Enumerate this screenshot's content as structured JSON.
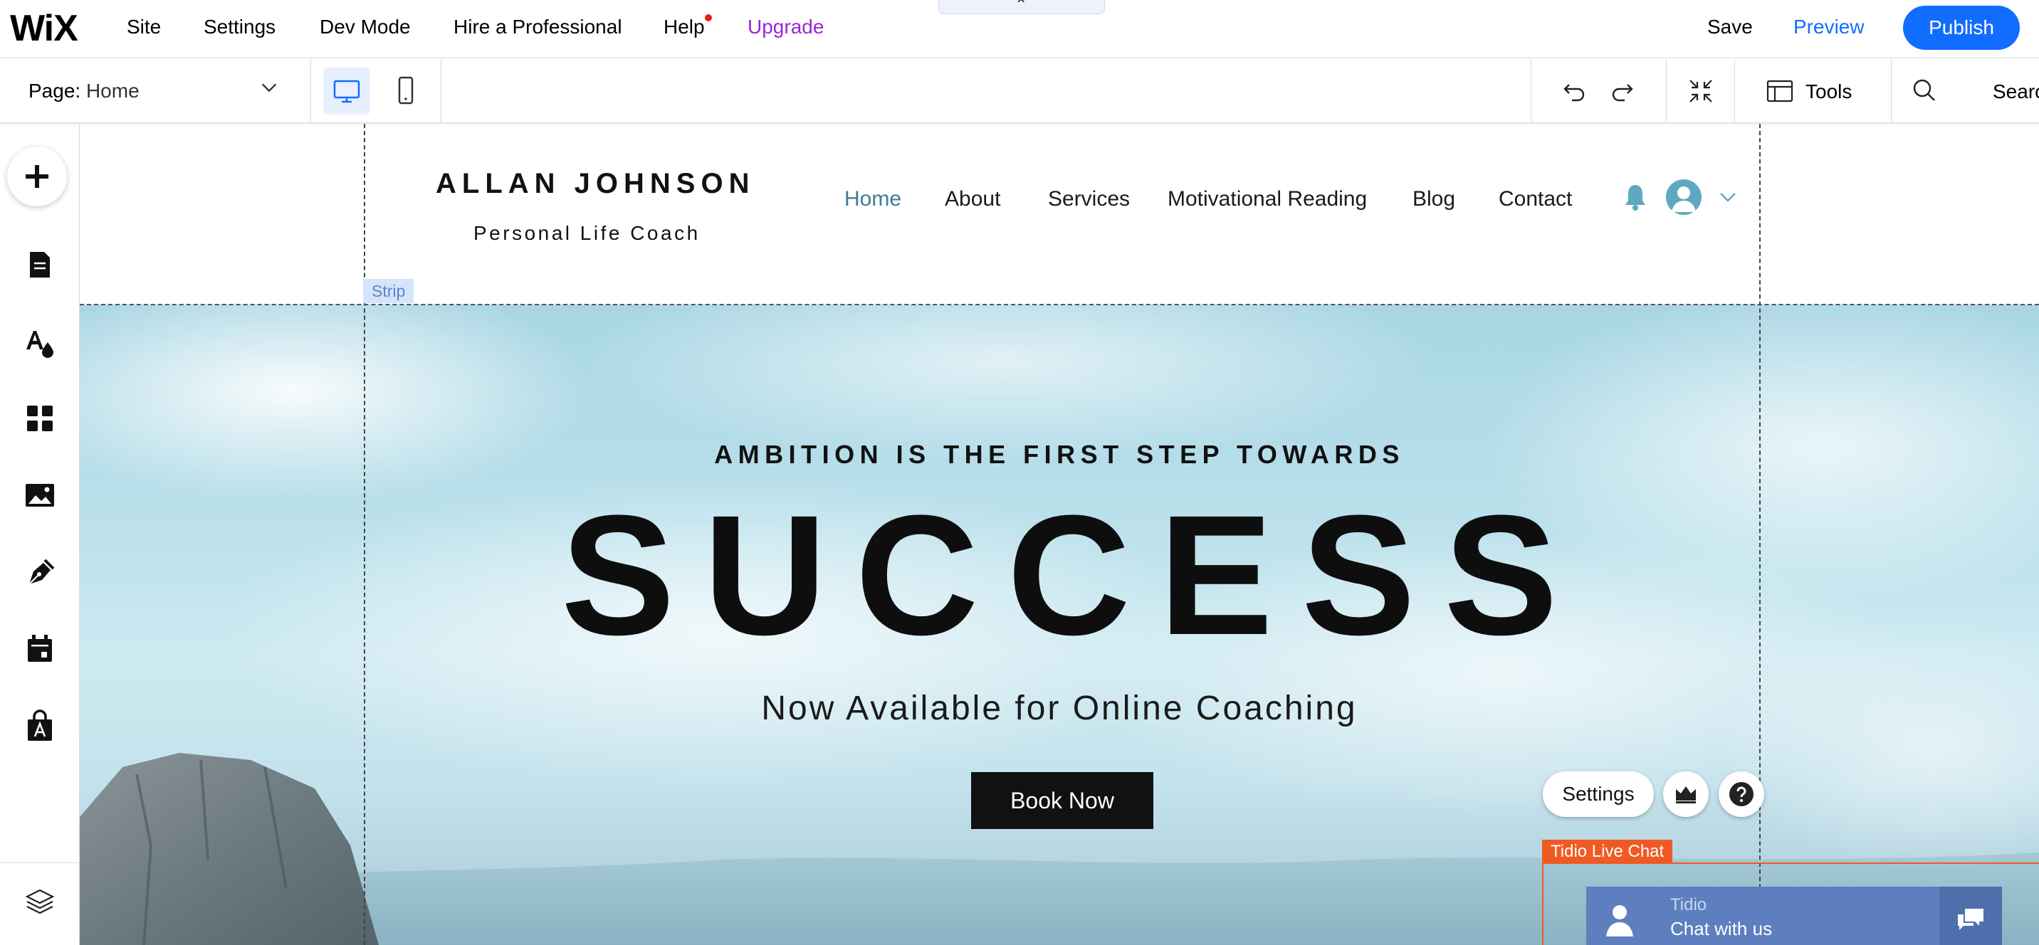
{
  "topbar": {
    "logo": "WiX",
    "menu": [
      "Site",
      "Settings",
      "Dev Mode",
      "Hire a Professional",
      "Help",
      "Upgrade"
    ],
    "save": "Save",
    "preview": "Preview",
    "publish": "Publish",
    "accent_color": "#116dff",
    "upgrade_color": "#9a27d5"
  },
  "toolbar": {
    "page_label": "Page:",
    "page_value": "Home",
    "tools": "Tools",
    "search": "Search",
    "device_selected": "desktop"
  },
  "sidebar": {
    "icons": [
      "add-icon",
      "pages-icon",
      "design-icon",
      "apps-icon",
      "media-icon",
      "blog-pen-icon",
      "bookings-calendar-icon",
      "store-bag-icon",
      "layers-icon"
    ]
  },
  "canvas": {
    "strip_label": "Strip",
    "site": {
      "name": "ALLAN JOHNSON",
      "tagline": "Personal Life Coach",
      "nav": [
        "Home",
        "About",
        "Services",
        "Motivational Reading",
        "Blog",
        "Contact"
      ],
      "nav_active_color": "#3f7c95"
    },
    "hero": {
      "kicker": "AMBITION IS THE FIRST STEP TOWARDS",
      "title": "SUCCESS",
      "subtitle": "Now Available for Online Coaching",
      "cta": "Book Now"
    },
    "floating": {
      "settings": "Settings"
    },
    "tidio": {
      "label": "Tidio Live Chat",
      "name": "Tidio",
      "message": "Chat with us",
      "label_color": "#f05a22"
    }
  }
}
